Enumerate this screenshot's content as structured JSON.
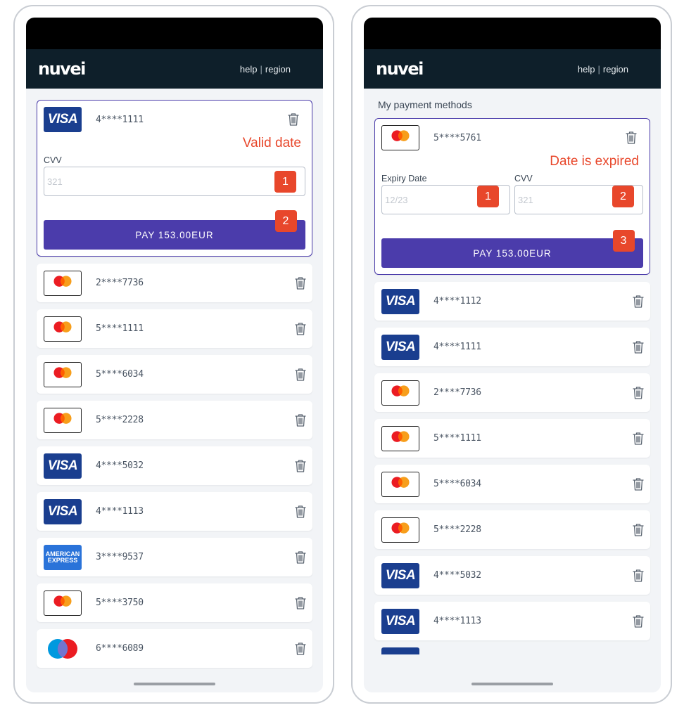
{
  "header": {
    "logo": "nuvei",
    "help": "help",
    "separator": "|",
    "region": "region"
  },
  "left": {
    "expanded": {
      "brand": "visa",
      "number": "4****1111",
      "notice": "Valid date",
      "cvv_label": "CVV",
      "cvv_placeholder": "321",
      "badge1": "1",
      "badge2": "2",
      "pay_label": "PAY 153.00EUR"
    },
    "cards": [
      {
        "brand": "mastercard",
        "number": "2****7736"
      },
      {
        "brand": "mastercard",
        "number": "5****1111"
      },
      {
        "brand": "mastercard",
        "number": "5****6034"
      },
      {
        "brand": "mastercard",
        "number": "5****2228"
      },
      {
        "brand": "visa",
        "number": "4****5032"
      },
      {
        "brand": "visa",
        "number": "4****1113"
      },
      {
        "brand": "amex",
        "number": "3****9537"
      },
      {
        "brand": "mastercard",
        "number": "5****3750"
      },
      {
        "brand": "maestro",
        "number": "6****6089"
      }
    ]
  },
  "right": {
    "section_title": "My payment methods",
    "expanded": {
      "brand": "mastercard",
      "number": "5****5761",
      "notice": "Date is expired",
      "expiry_label": "Expiry Date",
      "expiry_placeholder": "12/23",
      "cvv_label": "CVV",
      "cvv_placeholder": "321",
      "badge1": "1",
      "badge2": "2",
      "badge3": "3",
      "pay_label": "PAY 153.00EUR"
    },
    "cards": [
      {
        "brand": "visa",
        "number": "4****1112"
      },
      {
        "brand": "visa",
        "number": "4****1111"
      },
      {
        "brand": "mastercard",
        "number": "2****7736"
      },
      {
        "brand": "mastercard",
        "number": "5****1111"
      },
      {
        "brand": "mastercard",
        "number": "5****6034"
      },
      {
        "brand": "mastercard",
        "number": "5****2228"
      },
      {
        "brand": "visa",
        "number": "4****5032"
      },
      {
        "brand": "visa",
        "number": "4****1113"
      }
    ]
  },
  "brand_text": {
    "visa": "VISA",
    "mastercard": "mastercard",
    "amex_line1": "AMERICAN",
    "amex_line2": "EXPRESS",
    "maestro": "Maestro"
  },
  "colors": {
    "accent": "#4b3cab",
    "warning": "#e8472b",
    "header_bg": "#0e1f2a",
    "visa_blue": "#1a3e8f",
    "amex_blue": "#2a73d9"
  }
}
